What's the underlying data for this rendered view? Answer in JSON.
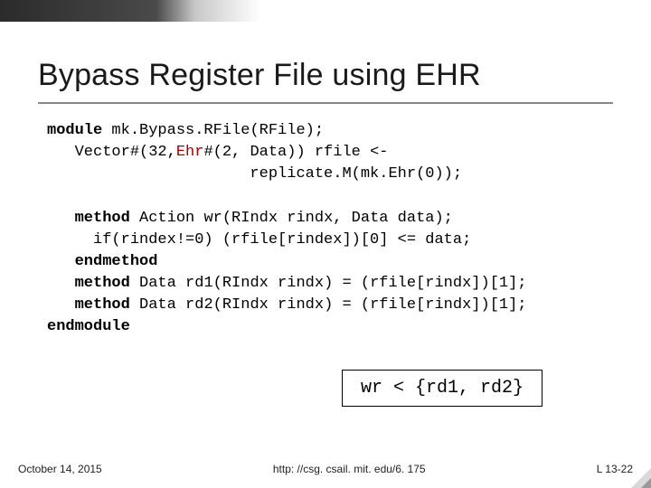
{
  "title": "Bypass Register File using EHR",
  "code": {
    "l1_kw": "module",
    "l1_rest": " mk.Bypass.RFile(RFile);",
    "l2_a": "   Vector#(32,",
    "l2_ty": "Ehr",
    "l2_b": "#(2, Data)) rfile <-",
    "l3": "                      replicate.M(mk.Ehr(0));",
    "blank1": "",
    "l4_a": "   ",
    "l4_kw": "method",
    "l4_b": " Action wr(RIndx rindx, Data data);",
    "l5": "     if(rindex!=0) (rfile[rindex])[0] <= data;",
    "l6_a": "   ",
    "l6_kw": "endmethod",
    "l7_a": "   ",
    "l7_kw": "method",
    "l7_b": " Data rd1(RIndx rindx) = (rfile[rindx])[1];",
    "l8_a": "   ",
    "l8_kw": "method",
    "l8_b": " Data rd2(RIndx rindx) = (rfile[rindx])[1];",
    "l9_kw": "endmodule"
  },
  "callout": "wr < {rd1, rd2}",
  "footer": {
    "date": "October 14, 2015",
    "url": "http: //csg. csail. mit. edu/6. 175",
    "slide_no": "L 13-22"
  }
}
